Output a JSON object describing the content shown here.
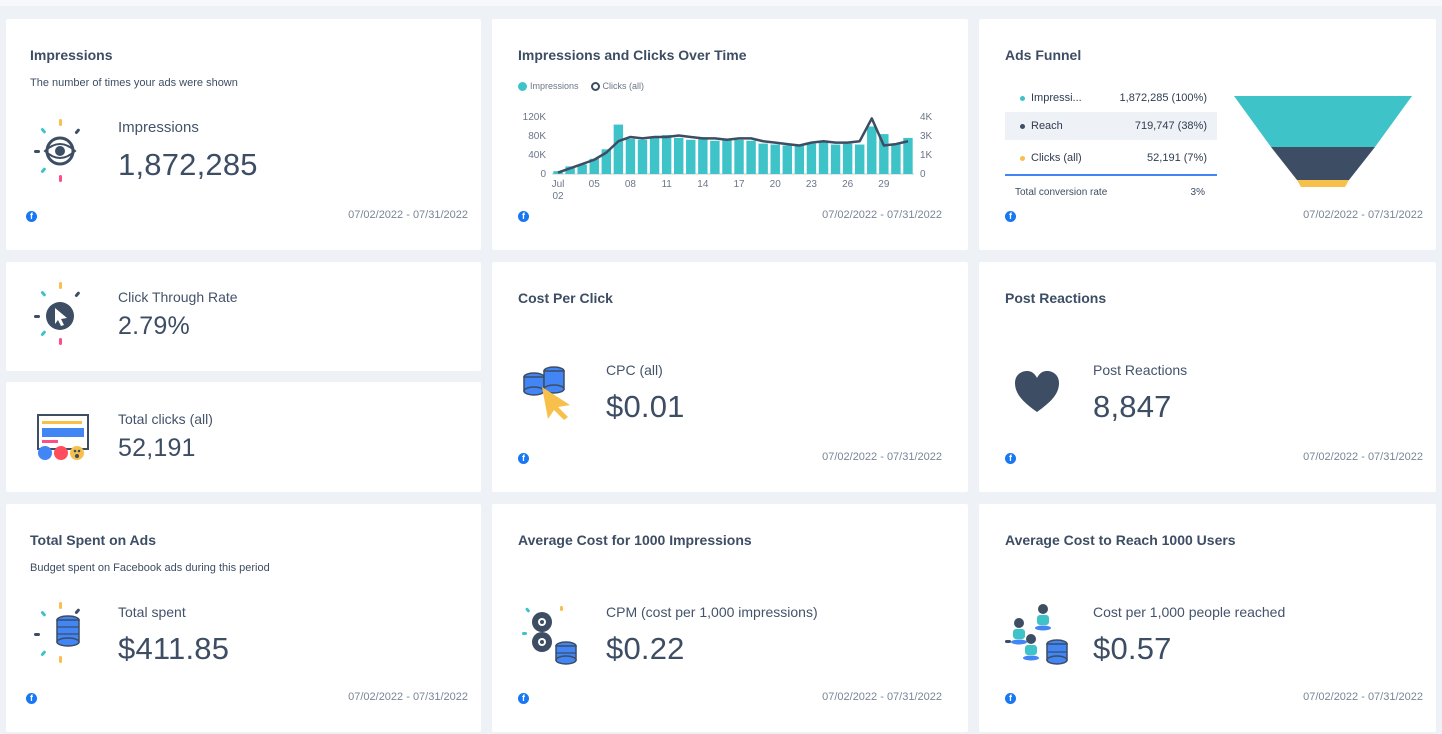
{
  "date_range": "07/02/2022 - 07/31/2022",
  "source_icon": "facebook-icon",
  "colors": {
    "teal": "#3ec3c8",
    "navy": "#3d4d63",
    "yellow": "#f7c04a",
    "blue": "#4285f4"
  },
  "impressions_card": {
    "title": "Impressions",
    "subtitle": "The number of times your ads were shown",
    "label": "Impressions",
    "value": "1,872,285",
    "icon": "eye-icon"
  },
  "chart_card": {
    "title": "Impressions and Clicks Over Time",
    "legend": [
      "Impressions",
      "Clicks (all)"
    ]
  },
  "chart_data": {
    "type": "bar",
    "x": [
      "Jul 02",
      "03",
      "04",
      "05",
      "06",
      "07",
      "08",
      "09",
      "10",
      "11",
      "12",
      "13",
      "14",
      "15",
      "16",
      "17",
      "18",
      "19",
      "20",
      "21",
      "22",
      "23",
      "24",
      "25",
      "26",
      "27",
      "28",
      "29",
      "30",
      "31"
    ],
    "x_tick_labels": [
      "Jul",
      "02",
      "05",
      "08",
      "11",
      "14",
      "17",
      "20",
      "23",
      "26",
      "29"
    ],
    "y_left_ticks": [
      "120K",
      "80K",
      "40K",
      "0"
    ],
    "y_right_ticks": [
      "4K",
      "3K",
      "1K",
      "0"
    ],
    "ylim_left": [
      0,
      120000
    ],
    "ylim_right": [
      0,
      4000
    ],
    "series": [
      {
        "name": "Impressions",
        "type": "bar",
        "axis": "left",
        "values": [
          6000,
          16000,
          20000,
          32000,
          52000,
          104000,
          74000,
          72000,
          78000,
          82000,
          76000,
          72000,
          74000,
          70000,
          72000,
          72000,
          70000,
          64000,
          62000,
          60000,
          60000,
          64000,
          70000,
          62000,
          64000,
          62000,
          100000,
          84000,
          64000,
          76000
        ]
      },
      {
        "name": "Clicks (all)",
        "type": "line",
        "axis": "right",
        "values": [
          100,
          400,
          700,
          1000,
          1500,
          2300,
          2600,
          2500,
          2600,
          2600,
          2700,
          2600,
          2500,
          2500,
          2400,
          2500,
          2500,
          2300,
          2200,
          2100,
          2000,
          2200,
          2300,
          2200,
          2200,
          2300,
          3900,
          2000,
          2100,
          2300
        ]
      }
    ]
  },
  "funnel_card": {
    "title": "Ads Funnel",
    "rows": [
      {
        "name": "Impressi...",
        "value": "1,872,285",
        "pct": "(100%)"
      },
      {
        "name": "Reach",
        "value": "719,747",
        "pct": "(38%)"
      },
      {
        "name": "Clicks (all)",
        "value": "52,191",
        "pct": "(7%)"
      }
    ],
    "total_label": "Total conversion rate",
    "total_value": "3%",
    "levels": [
      1.0,
      0.38,
      0.07
    ]
  },
  "ctr_card": {
    "label": "Click Through Rate",
    "value": "2.79%",
    "icon": "cursor-click-icon"
  },
  "clicks_card": {
    "label": "Total clicks (all)",
    "value": "52,191",
    "icon": "ad-reactions-icon"
  },
  "cpc_card": {
    "title": "Cost Per Click",
    "label": "CPC (all)",
    "value": "$0.01",
    "icon": "coins-cursor-icon"
  },
  "reactions_card": {
    "title": "Post Reactions",
    "label": "Post Reactions",
    "value": "8,847",
    "icon": "heart-icon"
  },
  "spent_card": {
    "title": "Total Spent on Ads",
    "subtitle": "Budget spent on Facebook ads during this period",
    "label": "Total spent",
    "value": "$411.85",
    "icon": "coins-stack-icon"
  },
  "cpm_card": {
    "title": "Average Cost for 1000 Impressions",
    "label": "CPM (cost per 1,000 impressions)",
    "value": "$0.22",
    "icon": "eyes-coins-icon"
  },
  "reach_cost_card": {
    "title": "Average Cost to Reach 1000 Users",
    "label": "Cost per 1,000 people reached",
    "value": "$0.57",
    "icon": "people-coins-icon"
  }
}
